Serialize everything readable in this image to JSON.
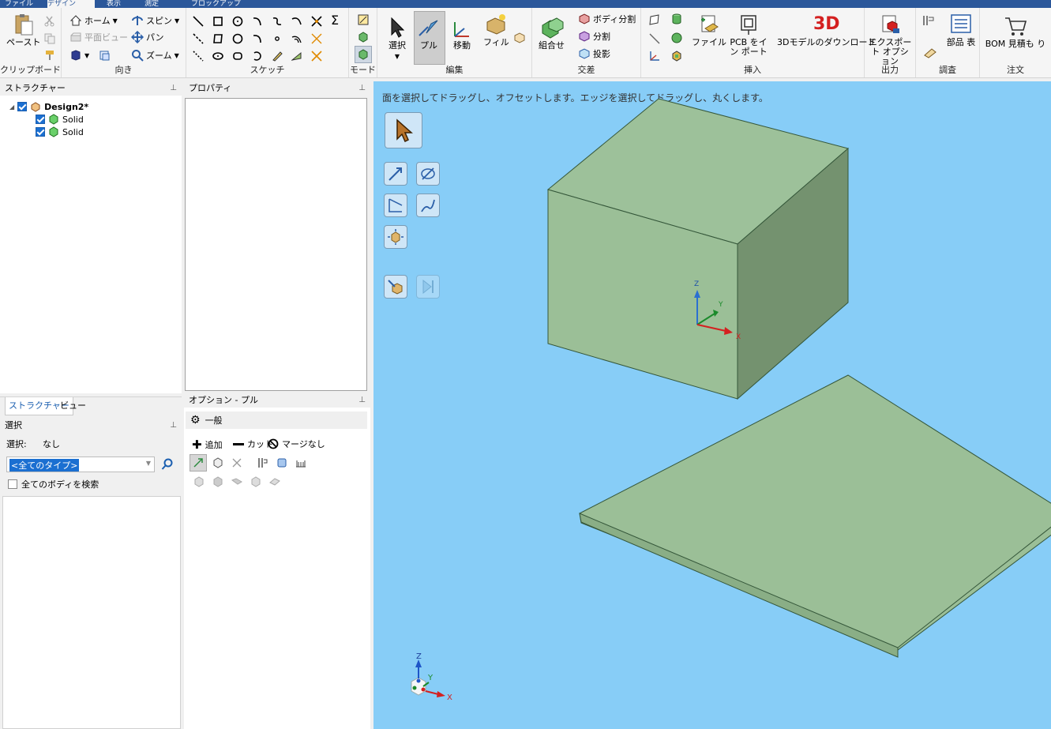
{
  "tabs": [
    "ファイル",
    "デザイン",
    "表示",
    "測定",
    "ブロックアップ"
  ],
  "ribbon": {
    "clipboard": {
      "paste": "ペースト",
      "label": "クリップボード"
    },
    "orient": {
      "home": "ホーム",
      "plan_view": "平面ビュー",
      "spin": "スピン",
      "pan": "パン",
      "zoom": "ズーム",
      "label": "向き"
    },
    "sketch": {
      "label": "スケッチ",
      "sigma": "Σ"
    },
    "mode": {
      "label": "モード"
    },
    "edit": {
      "select": "選択",
      "pull": "プル",
      "move": "移動",
      "fill": "フィル",
      "label": "編集"
    },
    "intersect": {
      "combine": "組合せ",
      "split_body": "ボディ分割",
      "split": "分割",
      "project": "投影",
      "label": "交差"
    },
    "insert": {
      "file": "ファイル",
      "pcb_import": "PCB をイン ポート",
      "download_3d": "3Dモデルのダウンロード",
      "logo_3d": "3D",
      "label": "挿入"
    },
    "output": {
      "export_options": "エクスポート オプション",
      "label": "出力"
    },
    "investigate": {
      "parts_list": "部品 表",
      "label": "調査"
    },
    "order": {
      "bom_quote": "BOM 見積も り",
      "label": "注文"
    }
  },
  "structure_panel": {
    "title": "ストラクチャー",
    "root": "Design2*",
    "children": [
      "Solid",
      "Solid"
    ],
    "tabs": [
      "ストラクチャー",
      "ビュー"
    ]
  },
  "properties_panel": {
    "title": "プロパティ"
  },
  "selection_panel": {
    "title": "選択",
    "selection_label": "選択:",
    "selection_value": "なし",
    "type_filter": "<全てのタイプ>",
    "search_all_bodies": "全てのボディを検索"
  },
  "options_panel": {
    "title": "オプション - プル",
    "general": "一般",
    "add": "追加",
    "cut": "カット",
    "no_merge": "マージなし"
  },
  "viewport": {
    "hint": "面を選択してドラッグし、オフセットします。エッジを選択してドラッグし、丸くします。",
    "axis_x": "X",
    "axis_y": "Y",
    "axis_z": "Z"
  },
  "colors": {
    "accent": "#2b579a",
    "viewport_bg": "#87cdf7",
    "solid": "#9bbf97",
    "solid_dark": "#74926f"
  }
}
